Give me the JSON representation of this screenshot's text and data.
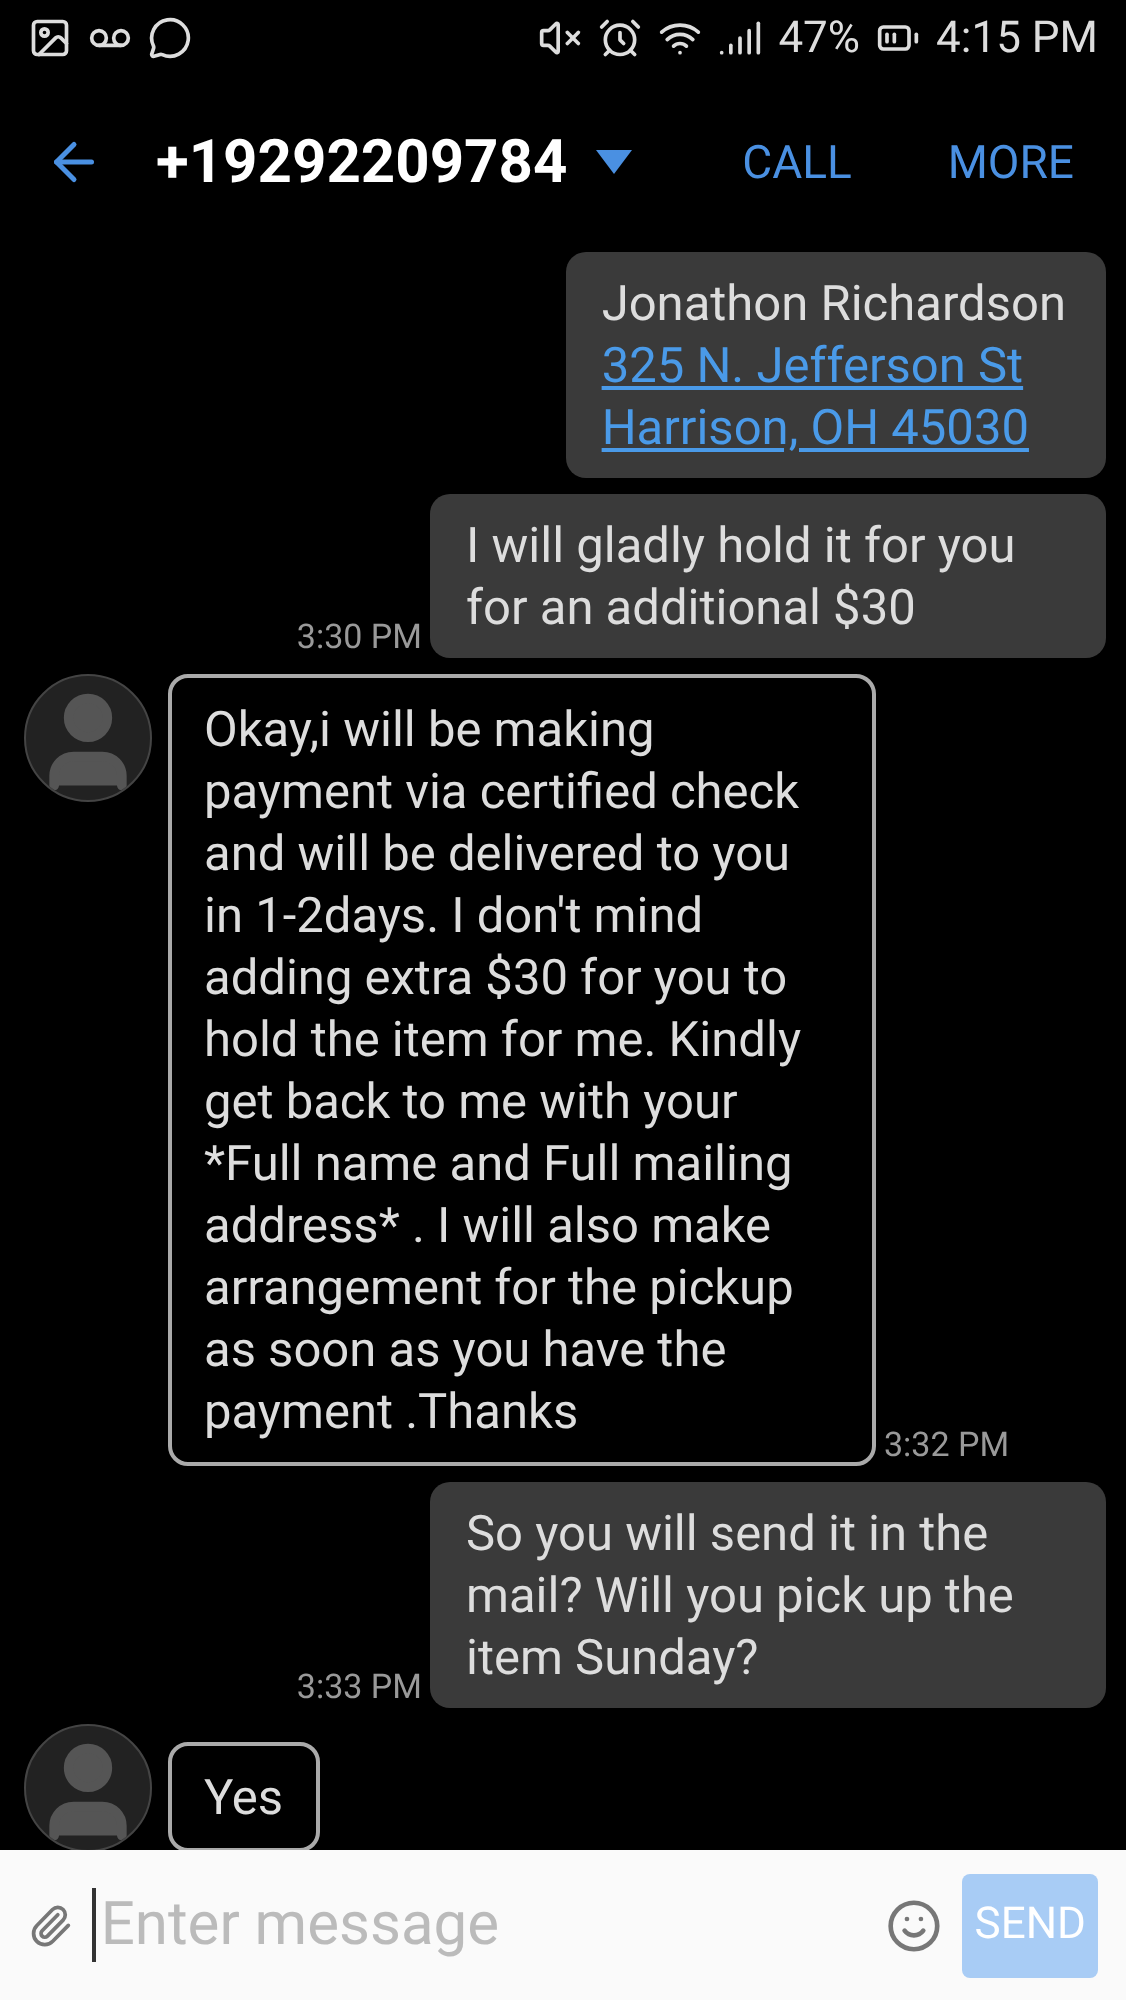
{
  "status_bar": {
    "battery": "47%",
    "time": "4:15 PM"
  },
  "header": {
    "title": "+19292209784",
    "actions": [
      "CALL",
      "MORE"
    ]
  },
  "messages": [
    {
      "kind": "outgoing",
      "lines": [
        {
          "kind": "text",
          "text": "Jonathon Richardson"
        },
        {
          "kind": "link",
          "text": "325 N. Jefferson St"
        },
        {
          "kind": "link",
          "text": "Harrison, OH 45030"
        }
      ]
    },
    {
      "kind": "outgoing",
      "time": "3:30 PM",
      "lines": [
        {
          "kind": "text",
          "text": "I will gladly hold it for you for an additional $30"
        }
      ]
    },
    {
      "kind": "incoming",
      "time": "3:32 PM",
      "lines": [
        {
          "kind": "text",
          "text": "Okay,i will be making payment via certified check and will be delivered to you in 1-2days. I don't mind adding extra $30 for you to hold the item for me. Kindly get back to me with your *Full name and Full mailing address* . I will also make arrangement for the pickup as soon as you have the payment .Thanks"
        }
      ]
    },
    {
      "kind": "outgoing",
      "time": "3:33 PM",
      "lines": [
        {
          "kind": "text",
          "text": "So you will send it in the mail? Will you pick up the item Sunday?"
        }
      ]
    },
    {
      "kind": "incoming",
      "lines": [
        {
          "kind": "text",
          "text": "Yes"
        }
      ]
    }
  ],
  "composer": {
    "placeholder": "Enter message",
    "send": "SEND"
  }
}
